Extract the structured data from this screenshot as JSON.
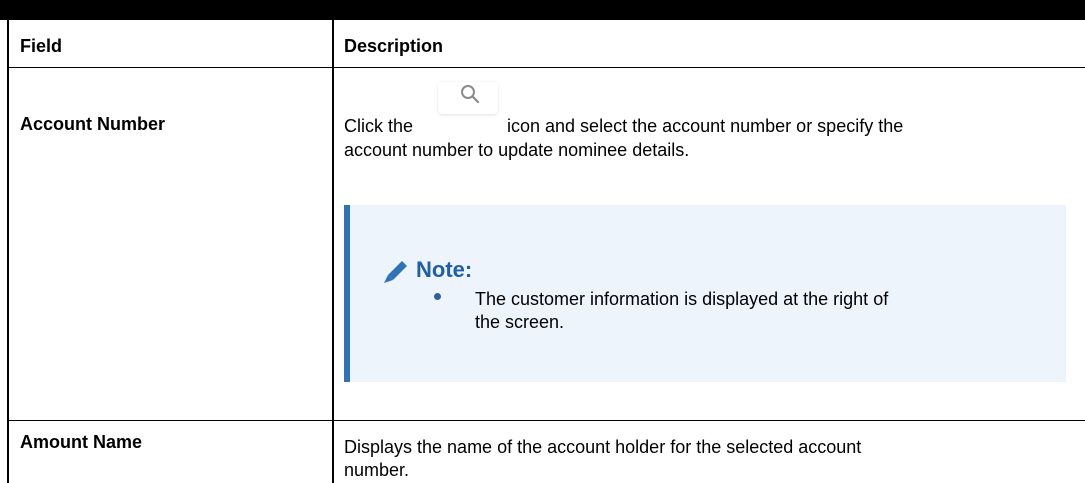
{
  "table": {
    "headers": {
      "field": "Field",
      "description": "Description"
    },
    "rows": [
      {
        "field": "Account Number",
        "desc_before_icon": "Click the",
        "desc_after_icon": "icon and select the account number or specify the",
        "desc_line2": "account number to update nominee details.",
        "icon": "search-icon",
        "note": {
          "title": "Note:",
          "bullets": [
            {
              "line1": "The customer information is displayed at the right of",
              "line2": "the screen."
            }
          ]
        }
      },
      {
        "field": "Amount Name",
        "desc_line1": "Displays the name of the account holder for the selected account",
        "desc_line2": "number."
      }
    ]
  },
  "colors": {
    "accent": "#2e72b8",
    "note_bg": "#edf4fb",
    "note_title": "#1f5ea8"
  }
}
